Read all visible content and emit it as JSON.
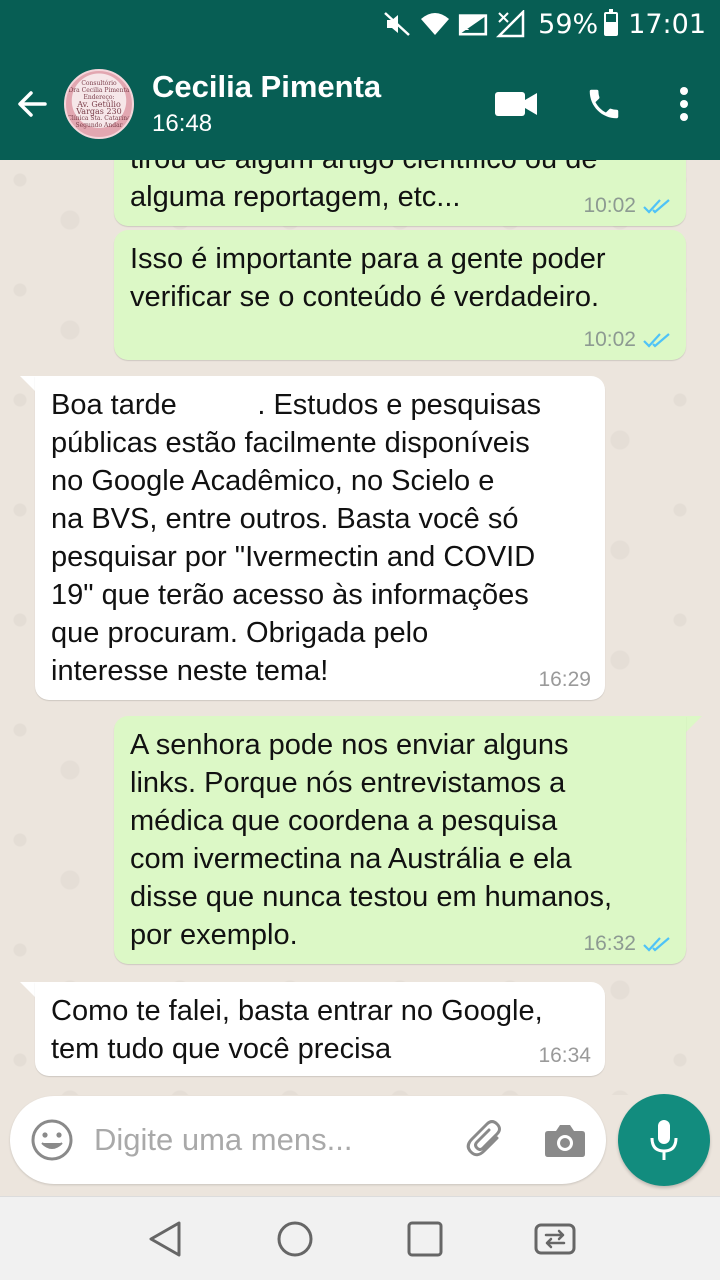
{
  "status_bar": {
    "battery": "59%",
    "time": "17:01",
    "icons": [
      "mute-icon",
      "wifi-icon",
      "signal-icon",
      "no-signal-icon",
      "battery-icon"
    ]
  },
  "header": {
    "contact_name": "Cecilia Pimenta",
    "last_seen": "16:48",
    "avatar_lines": [
      "Consultório",
      "Dra Cecilia Pimenta",
      "Endereço:",
      "Av. Getúlio",
      "Vargas 230",
      "Clínica Sta. Catarina",
      "Segundo Andar"
    ],
    "icons": [
      "back-arrow-icon",
      "video-call-icon",
      "phone-icon",
      "more-vert-icon"
    ]
  },
  "messages": [
    {
      "direction": "out",
      "text": "tirou de algum artigo científico ou de\nalguma reportagem, etc...",
      "time": "10:02",
      "read": true
    },
    {
      "direction": "out",
      "text": "Isso é importante para a gente poder\nverificar se o conteúdo é verdadeiro.",
      "time": "10:02",
      "read": true
    },
    {
      "direction": "in",
      "text": "Boa tarde          . Estudos e pesquisas\npúblicas estão facilmente disponíveis\nno Google Acadêmico, no Scielo e\nna BVS, entre outros. Basta você só\npesquisar por \"Ivermectin and COVID\n19\" que terão acesso às informações\nque procuram. Obrigada pelo\ninteresse neste tema!",
      "time": "16:29"
    },
    {
      "direction": "out",
      "text": "A senhora pode nos enviar alguns\nlinks. Porque nós entrevistamos a\nmédica que coordena a pesquisa\ncom ivermectina na Austrália e ela\ndisse que nunca testou em humanos,\npor exemplo.",
      "time": "16:32",
      "read": true
    },
    {
      "direction": "in",
      "text": "Como te falei, basta entrar no Google,\ntem tudo que você precisa",
      "time": "16:34"
    }
  ],
  "composer": {
    "placeholder": "Digite uma mens...",
    "value": "",
    "icons": [
      "emoji-icon",
      "attach-icon",
      "camera-icon",
      "mic-icon"
    ]
  },
  "nav": {
    "icons": [
      "back-triangle-icon",
      "home-circle-icon",
      "recents-square-icon",
      "dual-window-icon"
    ]
  },
  "colors": {
    "header": "#075e54",
    "accent": "#128c7e",
    "outgoing_bubble": "#dcf8c6",
    "incoming_bubble": "#ffffff",
    "read_ticks": "#4fc3f7",
    "chat_background": "#ece5dd"
  }
}
